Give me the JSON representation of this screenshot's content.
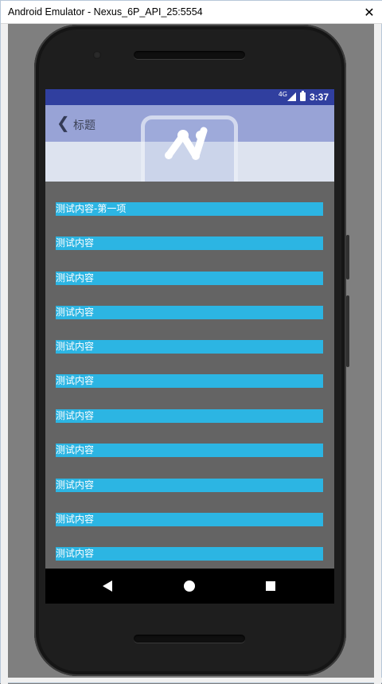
{
  "window": {
    "title": "Android Emulator - Nexus_6P_API_25:5554",
    "close_glyph": "✕"
  },
  "statusbar": {
    "network": "4G",
    "time": "3:37",
    "icons": [
      "signal-icon",
      "battery-icon"
    ]
  },
  "appbar": {
    "back_glyph": "❮",
    "title": "标题"
  },
  "list": {
    "items": [
      "测试内容-第一项",
      "测试内容",
      "测试内容",
      "测试内容",
      "测试内容",
      "测试内容",
      "测试内容",
      "测试内容",
      "测试内容",
      "测试内容",
      "测试内容"
    ]
  },
  "navbar": {
    "buttons": [
      "back-icon",
      "home-icon",
      "recents-icon"
    ]
  },
  "colors": {
    "statusbar": "#303f9f",
    "appbar": "#98a3d6",
    "list_item": "#2cb5e3",
    "list_bg": "#646464"
  }
}
